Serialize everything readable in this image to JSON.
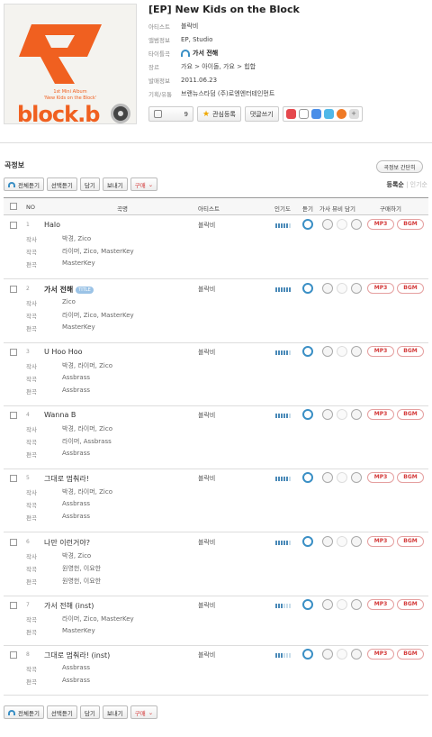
{
  "album": {
    "cover_subtitle_1": "1st Mini Album",
    "cover_subtitle_2": "'New Kids on the Block'",
    "cover_logo": "block.b",
    "title": "[EP] New Kids on the Block",
    "info": [
      {
        "key": "아티스트",
        "value": "블락비"
      },
      {
        "key": "앨범정보",
        "value": "EP, Studio"
      },
      {
        "key": "타이틀곡",
        "value": "가서 전해"
      },
      {
        "key": "장르",
        "value": "가요 > 아이돌, 가요 > 힙합"
      },
      {
        "key": "발매정보",
        "value": "2011.06.23"
      },
      {
        "key": "기획/유통",
        "value": "브랜뉴스타덤   (주)로엔엔터테인먼트"
      }
    ]
  },
  "actions": {
    "like_count": "9",
    "watch_label": "관심등록",
    "comment_label": "댓글쓰기",
    "more_label": "+"
  },
  "tracklist": {
    "section_title": "곡정보",
    "brief_label": "곡정보 간단히",
    "sort_active": "등록순",
    "sort_other": "인기순",
    "toolbar": {
      "play_all": "전체듣기",
      "play_selected": "선택듣기",
      "add": "담기",
      "send": "보내기",
      "buy": "구매"
    },
    "headers": {
      "no": "NO",
      "song": "곡명",
      "artist": "아티스트",
      "popularity": "인기도",
      "listen": "듣기",
      "extras": "가사 뮤비 담기",
      "buy": "구매하기"
    },
    "mp3_label": "MP3",
    "bgm_label": "BGM",
    "tracks": [
      {
        "no": "1",
        "title": "Halo",
        "is_title": false,
        "artist": "블락비",
        "popularity": 5,
        "credits": [
          {
            "k": "작사",
            "v": "박경, Zico"
          },
          {
            "k": "작곡",
            "v": "라이머, Zico, MasterKey"
          },
          {
            "k": "편곡",
            "v": "MasterKey"
          }
        ]
      },
      {
        "no": "2",
        "title": "가서 전해",
        "is_title": true,
        "badge": "TITLE",
        "artist": "블락비",
        "popularity": 6,
        "credits": [
          {
            "k": "작사",
            "v": "Zico"
          },
          {
            "k": "작곡",
            "v": "라이머, Zico, MasterKey"
          },
          {
            "k": "편곡",
            "v": "MasterKey"
          }
        ]
      },
      {
        "no": "3",
        "title": "U Hoo Hoo",
        "is_title": false,
        "artist": "블락비",
        "popularity": 5,
        "credits": [
          {
            "k": "작사",
            "v": "박경, 라이머, Zico"
          },
          {
            "k": "작곡",
            "v": "Assbrass"
          },
          {
            "k": "편곡",
            "v": "Assbrass"
          }
        ]
      },
      {
        "no": "4",
        "title": "Wanna B",
        "is_title": false,
        "artist": "블락비",
        "popularity": 5,
        "credits": [
          {
            "k": "작사",
            "v": "박경, 라이머, Zico"
          },
          {
            "k": "작곡",
            "v": "라이머, Assbrass"
          },
          {
            "k": "편곡",
            "v": "Assbrass"
          }
        ]
      },
      {
        "no": "5",
        "title": "그대로 멈춰라!",
        "is_title": false,
        "artist": "블락비",
        "popularity": 5,
        "credits": [
          {
            "k": "작사",
            "v": "박경, 라이머, Zico"
          },
          {
            "k": "작곡",
            "v": "Assbrass"
          },
          {
            "k": "편곡",
            "v": "Assbrass"
          }
        ]
      },
      {
        "no": "6",
        "title": "나만 이런거야?",
        "is_title": false,
        "artist": "블락비",
        "popularity": 5,
        "credits": [
          {
            "k": "작사",
            "v": "박경, Zico"
          },
          {
            "k": "작곡",
            "v": "원영헌, 이요한"
          },
          {
            "k": "편곡",
            "v": "원영헌, 이요한"
          }
        ]
      },
      {
        "no": "7",
        "title": "가서 전해 (inst)",
        "is_title": false,
        "artist": "블락비",
        "popularity": 3,
        "credits": [
          {
            "k": "작곡",
            "v": "라이머, Zico, MasterKey"
          },
          {
            "k": "편곡",
            "v": "MasterKey"
          }
        ]
      },
      {
        "no": "8",
        "title": "그대로 멈춰라! (inst)",
        "is_title": false,
        "artist": "블락비",
        "popularity": 3,
        "credits": [
          {
            "k": "작곡",
            "v": "Assbrass"
          },
          {
            "k": "편곡",
            "v": "Assbrass"
          }
        ]
      }
    ]
  },
  "colors": {
    "accent": "#3a8fc5",
    "buy": "#d43a3a",
    "cover_orange": "#f06020"
  }
}
